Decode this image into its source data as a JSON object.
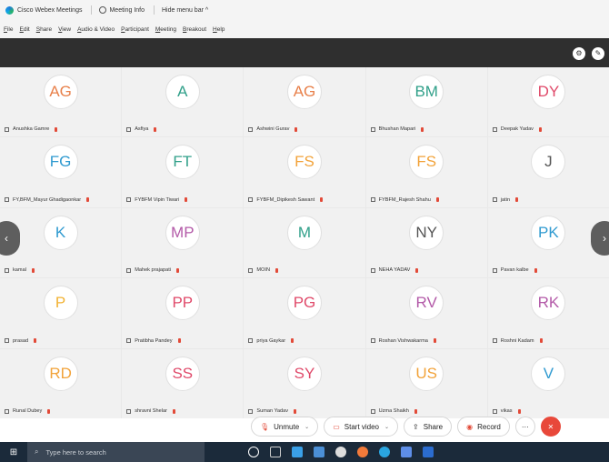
{
  "titlebar": {
    "app_title": "Cisco Webex Meetings",
    "meeting_info": "Meeting Info",
    "hide_menu_bar": "Hide menu bar ^"
  },
  "menubar": {
    "items": [
      "File",
      "Edit",
      "Share",
      "View",
      "Audio & Video",
      "Participant",
      "Meeting",
      "Breakout",
      "Help"
    ]
  },
  "participants": [
    {
      "initials": "AG",
      "name": "Anushka Gamre",
      "color": "#e8804a"
    },
    {
      "initials": "A",
      "name": "Asfiya",
      "color": "#31a08a"
    },
    {
      "initials": "AG",
      "name": "Ashwini Gurav",
      "color": "#e8804a"
    },
    {
      "initials": "BM",
      "name": "Bhushan Mapari",
      "color": "#31a08a"
    },
    {
      "initials": "DY",
      "name": "Deepak Yadav",
      "color": "#e04a6a"
    },
    {
      "initials": "FG",
      "name": "FY,BFM_Mayur Ghadigaonkar",
      "color": "#2f9ad0"
    },
    {
      "initials": "FT",
      "name": "FYBFM Vipin Tiwari",
      "color": "#31a08a"
    },
    {
      "initials": "FS",
      "name": "FYBFM_Dipikesh Sawant",
      "color": "#f2a33a"
    },
    {
      "initials": "FS",
      "name": "FYBFM_Rajesh Shahu",
      "color": "#f2a33a"
    },
    {
      "initials": "J",
      "name": "jatin",
      "color": "#555555"
    },
    {
      "initials": "K",
      "name": "kamal",
      "color": "#2f9ad0"
    },
    {
      "initials": "MP",
      "name": "Mahek prajapati",
      "color": "#b35aa8"
    },
    {
      "initials": "M",
      "name": "MOIN",
      "color": "#31a08a"
    },
    {
      "initials": "NY",
      "name": "NEHA YADAV",
      "color": "#555555"
    },
    {
      "initials": "PK",
      "name": "Pavan kalbe",
      "color": "#2f9ad0"
    },
    {
      "initials": "P",
      "name": "prasad",
      "color": "#f2b233"
    },
    {
      "initials": "PP",
      "name": "Pratibha Pandey",
      "color": "#e04a6a"
    },
    {
      "initials": "PG",
      "name": "priya Gaykar",
      "color": "#e04a6a"
    },
    {
      "initials": "RV",
      "name": "Roshan Vishwakarma",
      "color": "#b35aa8"
    },
    {
      "initials": "RK",
      "name": "Roshni Kadam",
      "color": "#b35aa8"
    },
    {
      "initials": "RD",
      "name": "Runal Dubey",
      "color": "#f2a33a"
    },
    {
      "initials": "SS",
      "name": "shravni Shelar",
      "color": "#e04a6a"
    },
    {
      "initials": "SY",
      "name": "Suman Yadav",
      "color": "#e04a6a"
    },
    {
      "initials": "US",
      "name": "Uzma Shaikh",
      "color": "#f2a33a"
    },
    {
      "initials": "V",
      "name": "vikas",
      "color": "#2f9ad0"
    }
  ],
  "controls": {
    "unmute": "Unmute",
    "start_video": "Start video",
    "share": "Share",
    "record": "Record",
    "more": "···",
    "end": "✕"
  },
  "taskbar": {
    "search_placeholder": "Type here to search"
  },
  "colors": {
    "end_call": "#e8483a",
    "mic_muted": "#e24a38",
    "toolbar_dark": "#2f2f2f",
    "taskbar": "#1b2a3a"
  }
}
